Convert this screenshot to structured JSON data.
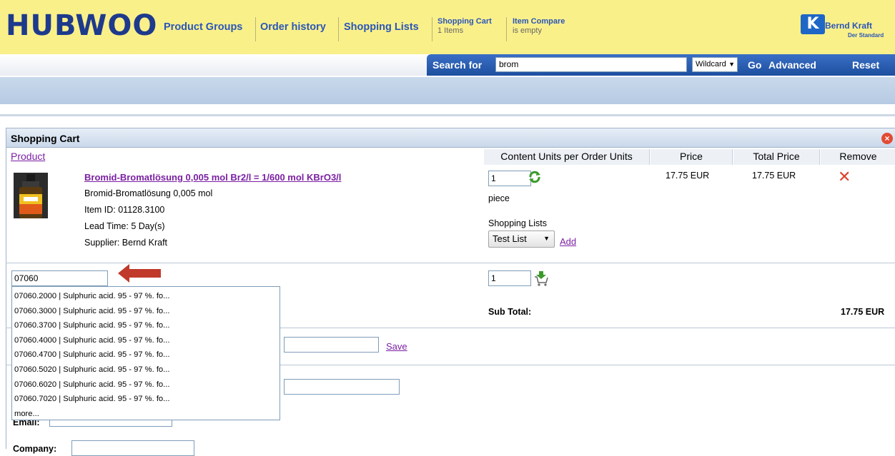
{
  "logo": "HUBWOO",
  "nav": {
    "product_groups": "Product Groups",
    "order_history": "Order history",
    "shopping_lists": "Shopping Lists",
    "cart_title": "Shopping Cart",
    "cart_count": "1 Items",
    "compare_title": "Item Compare",
    "compare_status": "is empty"
  },
  "brand": {
    "name": "Bernd Kraft",
    "tagline": "Der Standard",
    "icon": "K"
  },
  "search": {
    "label": "Search for",
    "value": "brom",
    "mode": "Wildcard",
    "go": "Go",
    "advanced": "Advanced",
    "reset": "Reset"
  },
  "cart": {
    "title": "Shopping Cart",
    "columns": {
      "product": "Product",
      "content_units": "Content Units per Order Units",
      "price": "Price",
      "total_price": "Total Price",
      "remove": "Remove"
    },
    "item": {
      "name": "Bromid-Bromatlösung 0,005 mol Br2/l = 1/600 mol KBrO3/l",
      "short_name": "Bromid-Bromatlösung 0,005 mol",
      "item_id": "Item ID: 01128.3100",
      "lead_time": "Lead Time: 5 Day(s)",
      "supplier": "Supplier: Bernd Kraft",
      "quantity": "1",
      "unit": "piece",
      "shopping_lists_label": "Shopping Lists",
      "shopping_list_selected": "Test List",
      "add_label": "Add",
      "price": "17.75 EUR",
      "total_price": "17.75 EUR"
    },
    "quick_add": {
      "value": "07060",
      "quantity": "1",
      "suggestions": [
        "07060.2000 | Sulphuric acid. 95 - 97 %. fo...",
        "07060.3000 | Sulphuric acid. 95 - 97 %. fo...",
        "07060.3700 | Sulphuric acid. 95 - 97 %. fo...",
        "07060.4000 | Sulphuric acid. 95 - 97 %. fo...",
        "07060.4700 | Sulphuric acid. 95 - 97 %. fo...",
        "07060.5020 | Sulphuric acid. 95 - 97 %. fo...",
        "07060.6020 | Sulphuric acid. 95 - 97 %. fo...",
        "07060.7020 | Sulphuric acid. 95 - 97 %. fo...",
        "more..."
      ]
    },
    "subtotal_label": "Sub Total:",
    "subtotal_value": "17.75 EUR",
    "save_label": "Save",
    "email_label": "Email:",
    "company_label": "Company:"
  },
  "colors": {
    "header_bg": "#faf08a",
    "nav_blue": "#2a56b8",
    "search_bar": "#1d4f9f",
    "link_purple": "#7b1fa2",
    "remove_red": "#e0402a"
  }
}
